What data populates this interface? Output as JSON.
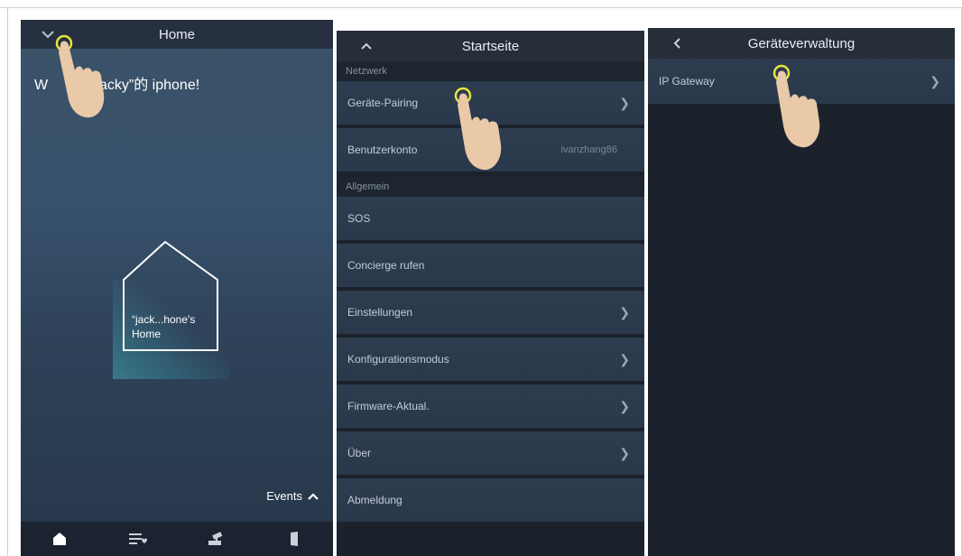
{
  "panel1": {
    "title": "Home",
    "welcome": "W            jacky”的 iphone!",
    "home_label_line1": "“jack...hone's",
    "home_label_line2": "Home",
    "events_label": "Events",
    "tabs": [
      "home-icon",
      "list-heart-icon",
      "camera-icon",
      "door-icon"
    ]
  },
  "panel2": {
    "title": "Startseite",
    "section_network": "Netzwerk",
    "section_general": "Allgemein",
    "rows": {
      "pairing": "Geräte-Pairing",
      "account": "Benutzerkonto",
      "account_value": "ivanzhang86",
      "sos": "SOS",
      "concierge": "Concierge rufen",
      "settings": "Einstellungen",
      "config": "Konfigurationsmodus",
      "firmware": "Firmware-Aktual.",
      "about": "Über",
      "logout": "Abmeldung"
    }
  },
  "panel3": {
    "title": "Geräteverwaltung",
    "rows": {
      "ip_gateway": "IP Gateway"
    }
  },
  "colors": {
    "touch_ring": "#e6e63c",
    "hand": "#e9c9a8"
  }
}
